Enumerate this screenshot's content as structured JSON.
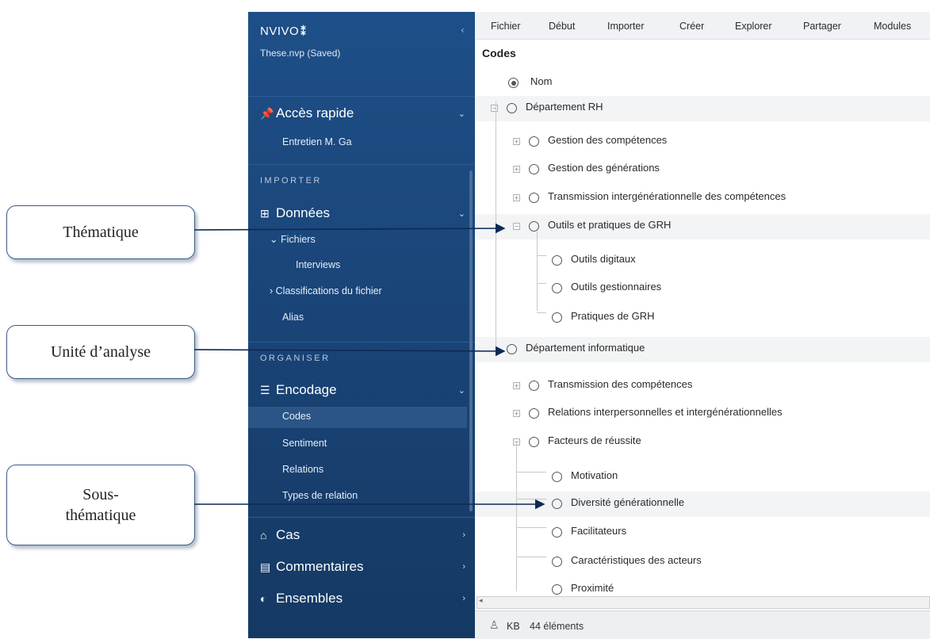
{
  "sidebar": {
    "app_name": "NVIVO",
    "logo_mark": "⁑",
    "collapse_icon": "chevron-left-icon",
    "project": "These.nvp (Saved)",
    "quick_access": {
      "label": "Accès rapide",
      "item": "Entretien M. Ga"
    },
    "import_label": "IMPORTER",
    "data": {
      "label": "Données",
      "files": "Fichiers",
      "interviews": "Interviews",
      "classifications": "Classifications du fichier",
      "aliases": "Alias"
    },
    "organize_label": "ORGANISER",
    "coding": {
      "label": "Encodage",
      "items": [
        "Codes",
        "Sentiment",
        "Relations",
        "Types de relation"
      ],
      "selected": "Codes"
    },
    "cases": "Cas",
    "comments": "Commentaires",
    "sets": "Ensembles"
  },
  "ribbon": {
    "menus": [
      "Fichier",
      "Début",
      "Importer",
      "Créer",
      "Explorer",
      "Partager",
      "Modules"
    ]
  },
  "main": {
    "title": "Codes",
    "header_column": "Nom",
    "tree": [
      {
        "label": "Département RH",
        "level": 0,
        "expander": "⊟"
      },
      {
        "label": "Gestion des compétences",
        "level": 1,
        "expander": "⊞"
      },
      {
        "label": "Gestion des générations",
        "level": 1,
        "expander": "⊞"
      },
      {
        "label": "Transmission intergénérationnelle des compétences",
        "level": 1,
        "expander": "⊞"
      },
      {
        "label": "Outils et pratiques de GRH",
        "level": 1,
        "expander": "⊟"
      },
      {
        "label": "Outils digitaux",
        "level": 2
      },
      {
        "label": "Outils gestionnaires",
        "level": 2
      },
      {
        "label": "Pratiques de GRH",
        "level": 2
      },
      {
        "label": "Département informatique",
        "level": 0
      },
      {
        "label": "Transmission des compétences",
        "level": 1,
        "expander": "⊞"
      },
      {
        "label": "Relations interpersonnelles et intergénérationnelles",
        "level": 1,
        "expander": "⊞"
      },
      {
        "label": "Facteurs de réussite",
        "level": 1,
        "expander": "⊟"
      },
      {
        "label": "Motivation",
        "level": 2
      },
      {
        "label": "Diversité générationnelle",
        "level": 2
      },
      {
        "label": "Facilitateurs",
        "level": 2
      },
      {
        "label": "Caractéristiques des acteurs",
        "level": 2
      },
      {
        "label": "Proximité",
        "level": 2
      }
    ]
  },
  "status": {
    "user_icon": "person-icon",
    "user": "KB",
    "count": "44 éléments"
  },
  "annotations": {
    "thematic": "Thématique",
    "unit": "Unité d’analyse",
    "subthematic_1": "Sous-",
    "subthematic_2": "thématique"
  },
  "colors": {
    "sidebar": "#1a4579",
    "callout_border": "#3a5a86",
    "arrow": "#0d2a55"
  }
}
